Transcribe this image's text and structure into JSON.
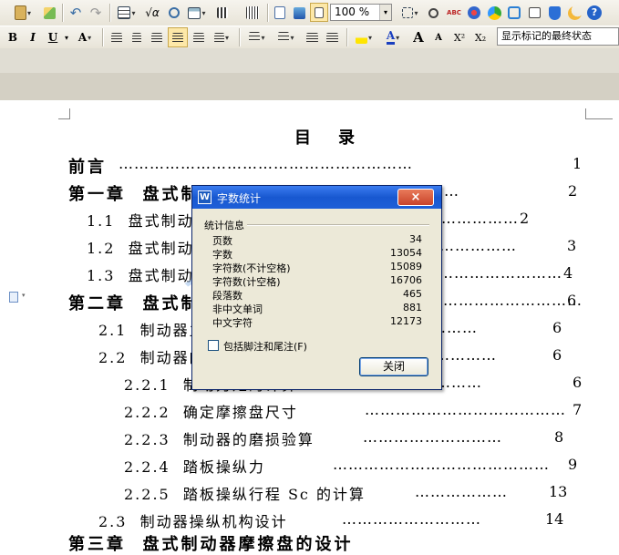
{
  "toolbar": {
    "zoom_value": "100 %",
    "style_value": "显示标记的最终状态",
    "format_labels": {
      "bold": "B",
      "italic": "I",
      "underline": "U",
      "superscript": "X²",
      "subscript": "X₂",
      "grow_font": "A",
      "shrink_font": "A"
    },
    "icons": [
      "paste-icon",
      "format-painter-icon",
      "undo-icon",
      "redo-icon",
      "table-icon",
      "formula-icon",
      "find-icon",
      "draw-table-icon",
      "columns-icon",
      "chart-icon",
      "document-map-icon",
      "preview-icon",
      "zoom-page-icon",
      "replace-icon",
      "spell-check-icon",
      "share-icon",
      "app-icon",
      "template-icon",
      "skin-icon",
      "shield-icon",
      "moon-icon",
      "help-icon"
    ]
  },
  "document": {
    "toc_heading": "目　录",
    "entries": [
      {
        "text": "前言",
        "dots": "…………………………………………………",
        "page": "1",
        "level": 0
      },
      {
        "text": "第一章  盘式制动器概述",
        "dots": "………………",
        "page": "2",
        "level": 1
      },
      {
        "text": "1.1  盘式制动器的工作原理",
        "dots": "………………",
        "page": "2",
        "level": 2
      },
      {
        "text": "1.2  盘式制动器的优点",
        "dots": "…………………",
        "page": "3",
        "level": 2
      },
      {
        "text": "1.3  盘式制动器的分类",
        "dots": "……………………",
        "page": "4",
        "level": 2
      },
      {
        "text": "第二章  盘式制动器的设计",
        "dots": "…………………………",
        "page": "6",
        "level": 1
      },
      {
        "text": "2.1  制动器主要参数的确定",
        "dots": "…………………",
        "page": "6",
        "level": 2
      },
      {
        "text": "2.2  制动器的设计计算",
        "dots": "……………………",
        "page": "6",
        "level": 2
      },
      {
        "text": "2.2.1  制动力矩的计算",
        "dots": "……………………",
        "page": "6",
        "level": 3
      },
      {
        "text": "2.2.2  确定摩擦盘尺寸",
        "dots": "…………………………………",
        "page": "7",
        "level": 3
      },
      {
        "text": "2.2.3  制动器的磨损验算",
        "dots": "………………………",
        "page": "8",
        "level": 3
      },
      {
        "text": "2.2.4  踏板操纵力",
        "dots": "……………………………………",
        "page": "9",
        "level": 3
      },
      {
        "text": "2.2.5  踏板操纵行程 Sc 的计算",
        "dots": "………………",
        "page": "13",
        "level": 3
      },
      {
        "text": "2.3  制动器操纵机构设计",
        "dots": "………………………",
        "page": "14",
        "level": 2
      }
    ],
    "cut_line": "第三章  盘式制动器摩擦盘的设计"
  },
  "watermark": {
    "chars": [
      "人",
      "文",
      "库"
    ],
    "url": "www.renrendoc.com"
  },
  "dialog": {
    "title": "字数统计",
    "close_x": "×",
    "group_label": "统计信息",
    "stats": [
      {
        "label": "页数",
        "value": "34"
      },
      {
        "label": "字数",
        "value": "13054"
      },
      {
        "label": "字符数(不计空格)",
        "value": "15089"
      },
      {
        "label": "字符数(计空格)",
        "value": "16706"
      },
      {
        "label": "段落数",
        "value": "465"
      },
      {
        "label": "非中文单词",
        "value": "881"
      },
      {
        "label": "中文字符",
        "value": "12173"
      }
    ],
    "checkbox_label": "包括脚注和尾注(F)",
    "checkbox_checked": false,
    "close_button": "关闭"
  }
}
